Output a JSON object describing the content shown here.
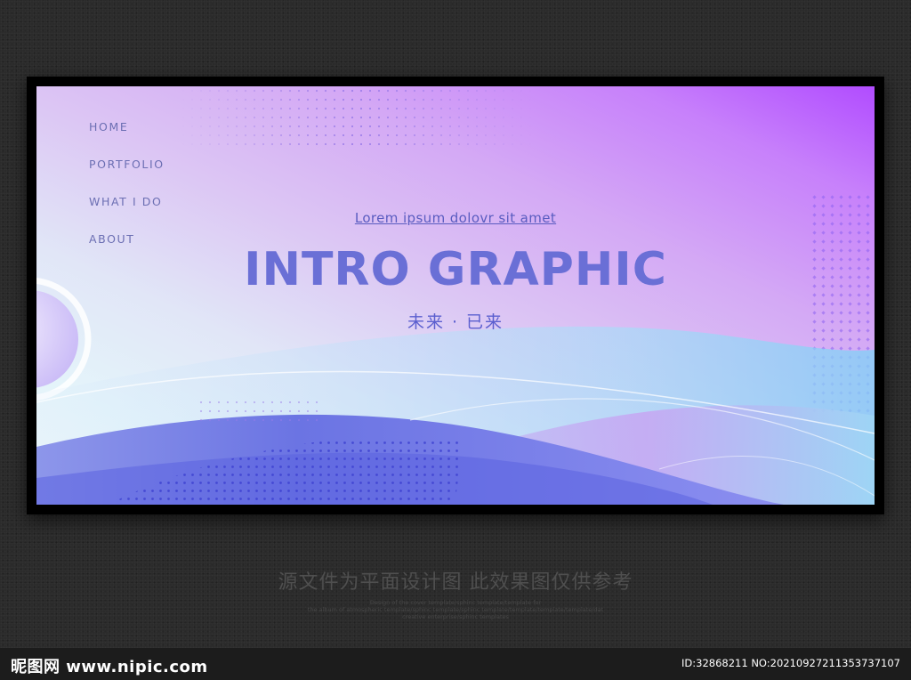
{
  "nav": {
    "items": [
      {
        "label": "HOME"
      },
      {
        "label": "PORTFOLIO"
      },
      {
        "label": "WHAT I DO"
      },
      {
        "label": "ABOUT"
      }
    ]
  },
  "hero": {
    "link_text": "Lorem ipsum dolovr sit amet",
    "title": "INTRO GRAPHIC",
    "subtitle": "未来 · 已来"
  },
  "caption": {
    "main": "源文件为平面设计图 此效果图仅供参考",
    "small_lines": [
      "Design of the cover template/sphinc template/template for",
      "the album of atmospheric template/sphinc template/sphinc template/template/template/template/dat",
      "creative enterprise/sphinc templates"
    ]
  },
  "footer": {
    "brand": "昵图网 www.nipic.com",
    "image_id": "ID:32868211 NO:20210927211353737107"
  },
  "colors": {
    "accent": "#6a6fd6",
    "nav_text": "#6c6fb3",
    "gradient_top_right": "#b14cff",
    "wave_blue": "#5b63e0",
    "background": "#2b2b2b"
  }
}
